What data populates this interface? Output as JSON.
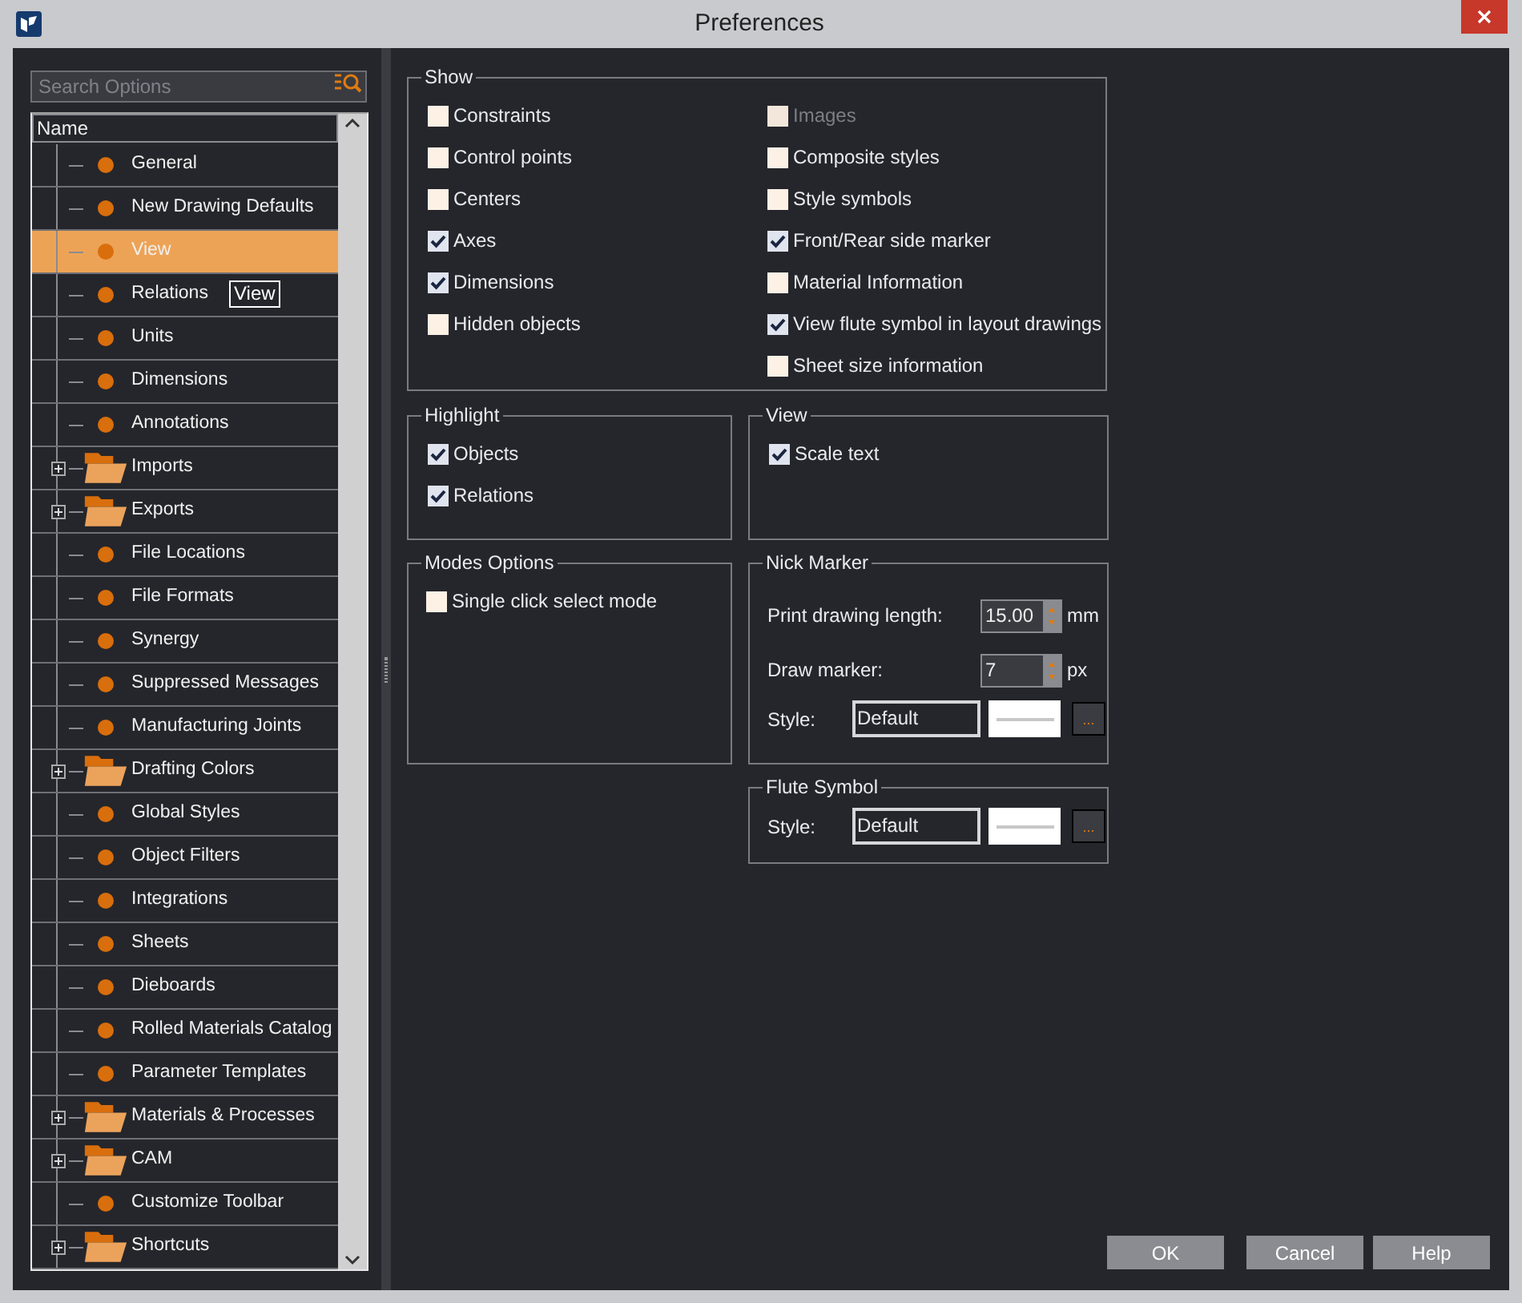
{
  "window": {
    "title": "Preferences"
  },
  "search": {
    "placeholder": "Search Options"
  },
  "tree": {
    "column": "Name",
    "tooltip": "View",
    "items": [
      {
        "label": "General",
        "kind": "leaf",
        "selected": false
      },
      {
        "label": "New Drawing Defaults",
        "kind": "leaf",
        "selected": false
      },
      {
        "label": "View",
        "kind": "leaf",
        "selected": true
      },
      {
        "label": "Relations",
        "kind": "leaf",
        "selected": false
      },
      {
        "label": "Units",
        "kind": "leaf",
        "selected": false
      },
      {
        "label": "Dimensions",
        "kind": "leaf",
        "selected": false
      },
      {
        "label": "Annotations",
        "kind": "leaf",
        "selected": false
      },
      {
        "label": "Imports",
        "kind": "folder",
        "selected": false,
        "expanded": false
      },
      {
        "label": "Exports",
        "kind": "folder",
        "selected": false,
        "expanded": false
      },
      {
        "label": "File Locations",
        "kind": "leaf",
        "selected": false
      },
      {
        "label": "File Formats",
        "kind": "leaf",
        "selected": false
      },
      {
        "label": "Synergy",
        "kind": "leaf",
        "selected": false
      },
      {
        "label": "Suppressed Messages",
        "kind": "leaf",
        "selected": false
      },
      {
        "label": "Manufacturing Joints",
        "kind": "leaf",
        "selected": false
      },
      {
        "label": "Drafting Colors",
        "kind": "folder",
        "selected": false,
        "expanded": false
      },
      {
        "label": "Global Styles",
        "kind": "leaf",
        "selected": false
      },
      {
        "label": "Object Filters",
        "kind": "leaf",
        "selected": false
      },
      {
        "label": "Integrations",
        "kind": "leaf",
        "selected": false
      },
      {
        "label": "Sheets",
        "kind": "leaf",
        "selected": false
      },
      {
        "label": "Dieboards",
        "kind": "leaf",
        "selected": false
      },
      {
        "label": "Rolled Materials Catalog",
        "kind": "leaf",
        "selected": false
      },
      {
        "label": "Parameter Templates",
        "kind": "leaf",
        "selected": false
      },
      {
        "label": "Materials & Processes",
        "kind": "folder",
        "selected": false,
        "expanded": false
      },
      {
        "label": "CAM",
        "kind": "folder",
        "selected": false,
        "expanded": false
      },
      {
        "label": "Customize Toolbar",
        "kind": "leaf",
        "selected": false
      },
      {
        "label": "Shortcuts",
        "kind": "folder",
        "selected": false,
        "expanded": false
      }
    ]
  },
  "show": {
    "title": "Show",
    "left": [
      {
        "label": "Constraints",
        "checked": false,
        "disabled": false
      },
      {
        "label": "Control points",
        "checked": false,
        "disabled": false
      },
      {
        "label": "Centers",
        "checked": false,
        "disabled": false
      },
      {
        "label": "Axes",
        "checked": true,
        "disabled": false
      },
      {
        "label": "Dimensions",
        "checked": true,
        "disabled": false
      },
      {
        "label": "Hidden objects",
        "checked": false,
        "disabled": false
      }
    ],
    "right": [
      {
        "label": "Images",
        "checked": false,
        "disabled": true
      },
      {
        "label": "Composite styles",
        "checked": false,
        "disabled": false
      },
      {
        "label": "Style symbols",
        "checked": false,
        "disabled": false
      },
      {
        "label": "Front/Rear side marker",
        "checked": true,
        "disabled": false
      },
      {
        "label": "Material Information",
        "checked": false,
        "disabled": false
      },
      {
        "label": "View flute symbol in layout drawings",
        "checked": true,
        "disabled": false
      },
      {
        "label": "Sheet size information",
        "checked": false,
        "disabled": false
      }
    ]
  },
  "highlight": {
    "title": "Highlight",
    "items": [
      {
        "label": "Objects",
        "checked": true
      },
      {
        "label": "Relations",
        "checked": true
      }
    ]
  },
  "view": {
    "title": "View",
    "items": [
      {
        "label": "Scale text",
        "checked": true
      }
    ]
  },
  "modes": {
    "title": "Modes Options",
    "items": [
      {
        "label": "Single click select mode",
        "checked": false
      }
    ]
  },
  "nick_marker": {
    "title": "Nick Marker",
    "fields": [
      {
        "label": "Print drawing length:",
        "value": "15.00",
        "unit": "mm"
      },
      {
        "label": "Draw marker:",
        "value": "7",
        "unit": "px"
      }
    ],
    "style": {
      "label": "Style:",
      "value": "Default",
      "more": "..."
    }
  },
  "flute_symbol": {
    "title": "Flute Symbol",
    "style": {
      "label": "Style:",
      "value": "Default",
      "more": "..."
    }
  },
  "buttons": [
    "OK",
    "Cancel",
    "Help"
  ]
}
